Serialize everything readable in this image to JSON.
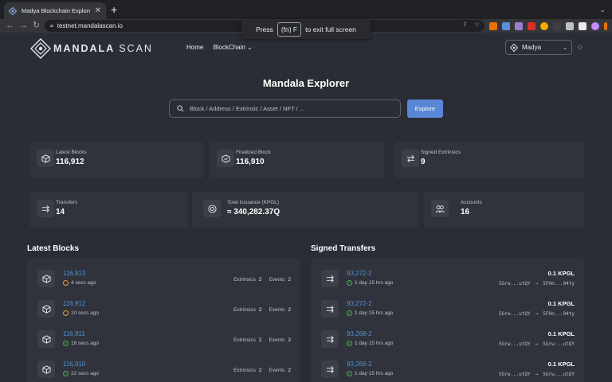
{
  "browser": {
    "tab_title": "Madya Blockchain Explorer",
    "tab_close": "✕",
    "new_tab": "+",
    "url": "testnet.mandalascan.io",
    "toast": {
      "press": "Press",
      "key": "(fn) F",
      "suffix": "to exit full screen"
    }
  },
  "header": {
    "logo_main": "MANDALA",
    "logo_sub": "SCAN",
    "nav": [
      {
        "label": "Home"
      },
      {
        "label": "BlockChain"
      }
    ],
    "network": "Madya"
  },
  "hero": {
    "title": "Mandala Explorer",
    "search_placeholder": "Block / Address / Extrinsic / Asset / NFT / ...",
    "explore_label": "Explore"
  },
  "stats": {
    "latest_blocks": {
      "label": "Latest Blocks",
      "value": "116,912"
    },
    "finalized_block": {
      "label": "Finalized Block",
      "value": "116,910"
    },
    "signed_extrinsics": {
      "label": "Signed Extrinsics",
      "value": "9"
    },
    "transfers": {
      "label": "Transfers",
      "value": "14"
    },
    "total_issuance": {
      "label": "Total Issuance (KPGL)",
      "value": "≈ 340,282.37Q"
    },
    "accounts": {
      "label": "Accounts",
      "value": "16"
    }
  },
  "latest_blocks": {
    "title": "Latest Blocks",
    "extrinsics_label": "Extrinsics",
    "events_label": "Events",
    "rows": [
      {
        "number": "116,913",
        "age": "4 secs ago",
        "extrinsics": "2",
        "events": "2",
        "status": "pending"
      },
      {
        "number": "116,912",
        "age": "10 secs ago",
        "extrinsics": "2",
        "events": "2",
        "status": "pending"
      },
      {
        "number": "116,911",
        "age": "16 secs ago",
        "extrinsics": "2",
        "events": "2",
        "status": "finalized"
      },
      {
        "number": "116,910",
        "age": "22 secs ago",
        "extrinsics": "2",
        "events": "2",
        "status": "finalized"
      }
    ]
  },
  "signed_transfers": {
    "title": "Signed Transfers",
    "rows": [
      {
        "id": "93,272-2",
        "age": "1 day 15 hrs ago",
        "amount": "0.1 KPGL",
        "from": "5Grw...utQY",
        "to": "5FHn...94ty"
      },
      {
        "id": "93,272-2",
        "age": "1 day 15 hrs ago",
        "amount": "0.1 KPGL",
        "from": "5Grw...utQY",
        "to": "5FHn...94ty"
      },
      {
        "id": "93,268-2",
        "age": "1 day 15 hrs ago",
        "amount": "0.1 KPGL",
        "from": "5Grw...utQY",
        "to": "5Grw...utQY"
      },
      {
        "id": "93,268-2",
        "age": "1 day 15 hrs ago",
        "amount": "0.1 KPGL",
        "from": "5Grw...utQY",
        "to": "5Grw...utQY"
      }
    ]
  },
  "colors": {
    "accent": "#5a86d6",
    "link": "#4f8fdb",
    "pending": "#e0a43a",
    "success": "#4caf50"
  }
}
